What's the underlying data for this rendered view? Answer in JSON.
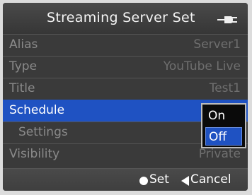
{
  "header": {
    "title": "Streaming Server Set",
    "icon": "plug-icon"
  },
  "rows": [
    {
      "label": "Alias",
      "value": "Server1"
    },
    {
      "label": "Type",
      "value": "YouTube Live"
    },
    {
      "label": "Title",
      "value": "Test1"
    },
    {
      "label": "Schedule",
      "value": ""
    },
    {
      "label": "Settings",
      "value": ""
    },
    {
      "label": "Visibility",
      "value": "Private"
    }
  ],
  "selected_row": "Schedule",
  "popup": {
    "options": [
      "On",
      "Off"
    ],
    "selected": "Off"
  },
  "footer": {
    "set_label": "Set",
    "cancel_label": "Cancel"
  },
  "colors": {
    "highlight": "#1f52c2",
    "panel": "#3a3a3a"
  }
}
